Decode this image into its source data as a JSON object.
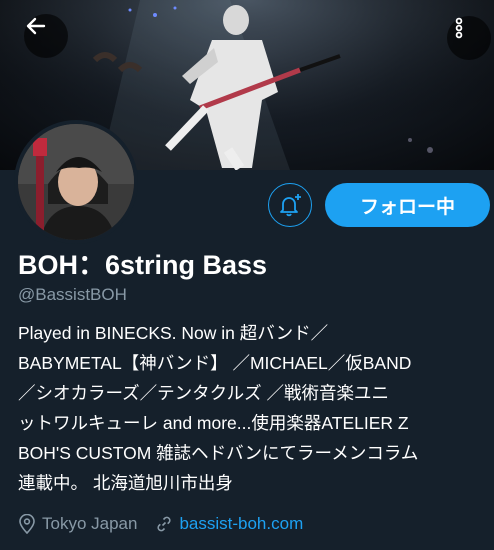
{
  "profile": {
    "display_name": "BOH：6string Bass",
    "handle": "@BassistBOH",
    "bio_lines": [
      "Played in BINECKS. Now in 超バンド／",
      "BABYMETAL【神バンド】 ／MICHAEL／仮BAND",
      "／シオカラーズ／テンタクルズ ／戦術音楽ユニ",
      "ットワルキューレ and more...使用楽器ATELIER Z",
      "BOH'S CUSTOM 雑誌ヘドバンにてラーメンコラム",
      "連載中。 北海道旭川市出身"
    ],
    "location": "Tokyo Japan",
    "website": "bassist-boh.com"
  },
  "actions": {
    "follow_label": "フォロー中"
  },
  "colors": {
    "background": "#15202b",
    "accent": "#1da1f2",
    "secondary_text": "#8899a6"
  },
  "icons": {
    "back": "arrow-left-icon",
    "more": "more-vertical-icon",
    "notify": "bell-plus-icon",
    "location": "location-pin-icon",
    "link": "link-icon"
  }
}
